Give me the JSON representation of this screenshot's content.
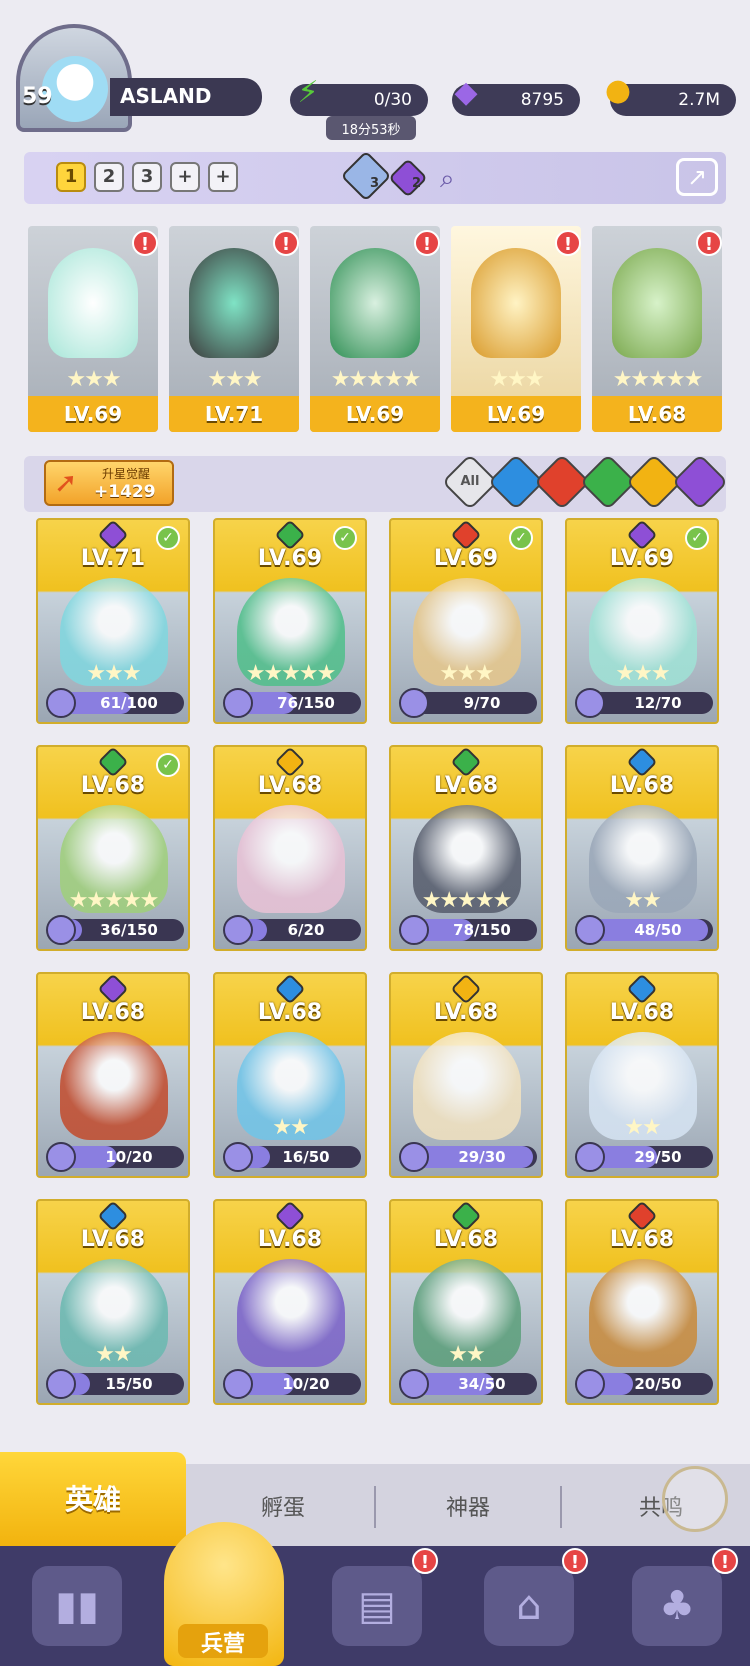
{
  "player": {
    "level": "59",
    "name": "ASLAND"
  },
  "resources": {
    "energy": "0/30",
    "energy_timer": "18分53秒",
    "gems": "8795",
    "gold": "2.7M"
  },
  "team": {
    "tabs": [
      "1",
      "2",
      "3",
      "+",
      "+"
    ],
    "active_tab": "1",
    "badge_a": "3",
    "badge_b": "2",
    "members": [
      {
        "level": "LV.69",
        "stars": "★★★",
        "element": "purple"
      },
      {
        "level": "LV.71",
        "stars": "★★★",
        "element": "purple"
      },
      {
        "level": "LV.69",
        "stars": "★★★★★",
        "element": "green"
      },
      {
        "level": "LV.69",
        "stars": "★★★",
        "element": "red"
      },
      {
        "level": "LV.68",
        "stars": "★★★★★",
        "element": "green"
      }
    ],
    "alert": "!"
  },
  "filter": {
    "upgrade_label": "升星觉醒",
    "upgrade_value": "+1429",
    "all_label": "All"
  },
  "heroes": [
    {
      "level": "LV.71",
      "shards": "61/100",
      "progress": 0.61,
      "stars": "★★★",
      "element": "purple",
      "check": true
    },
    {
      "level": "LV.69",
      "shards": "76/150",
      "progress": 0.51,
      "stars": "★★★★★",
      "element": "green",
      "check": true
    },
    {
      "level": "LV.69",
      "shards": "9/70",
      "progress": 0.13,
      "stars": "★★★",
      "element": "red",
      "check": true
    },
    {
      "level": "LV.69",
      "shards": "12/70",
      "progress": 0.17,
      "stars": "★★★",
      "element": "purple",
      "check": true
    },
    {
      "level": "LV.68",
      "shards": "36/150",
      "progress": 0.24,
      "stars": "★★★★★",
      "element": "green",
      "check": true
    },
    {
      "level": "LV.68",
      "shards": "6/20",
      "progress": 0.3,
      "stars": "",
      "element": "yellow",
      "check": false
    },
    {
      "level": "LV.68",
      "shards": "78/150",
      "progress": 0.52,
      "stars": "★★★★★",
      "element": "green",
      "check": false
    },
    {
      "level": "LV.68",
      "shards": "48/50",
      "progress": 0.96,
      "stars": "★★",
      "element": "blue",
      "check": false
    },
    {
      "level": "LV.68",
      "shards": "10/20",
      "progress": 0.5,
      "stars": "",
      "element": "purple",
      "check": false
    },
    {
      "level": "LV.68",
      "shards": "16/50",
      "progress": 0.32,
      "stars": "★★",
      "element": "blue",
      "check": false
    },
    {
      "level": "LV.68",
      "shards": "29/30",
      "progress": 0.97,
      "stars": "",
      "element": "yellow",
      "check": false
    },
    {
      "level": "LV.68",
      "shards": "29/50",
      "progress": 0.58,
      "stars": "★★",
      "element": "blue",
      "check": false
    },
    {
      "level": "LV.68",
      "shards": "15/50",
      "progress": 0.3,
      "stars": "★★",
      "element": "blue",
      "check": false
    },
    {
      "level": "LV.68",
      "shards": "10/20",
      "progress": 0.5,
      "stars": "",
      "element": "purple",
      "check": false
    },
    {
      "level": "LV.68",
      "shards": "34/50",
      "progress": 0.68,
      "stars": "★★",
      "element": "green",
      "check": false
    },
    {
      "level": "LV.68",
      "shards": "20/50",
      "progress": 0.4,
      "stars": "",
      "element": "red",
      "check": false
    }
  ],
  "sub_tabs": [
    "英雄",
    "孵蛋",
    "神器",
    "共鸣"
  ],
  "nav": {
    "center_label": "兵营",
    "alert": "!"
  },
  "colors": {
    "purple": "#8e4fd6",
    "green": "#3bb14a",
    "red": "#e0412c",
    "blue": "#2d8ee0",
    "yellow": "#f2b312"
  }
}
